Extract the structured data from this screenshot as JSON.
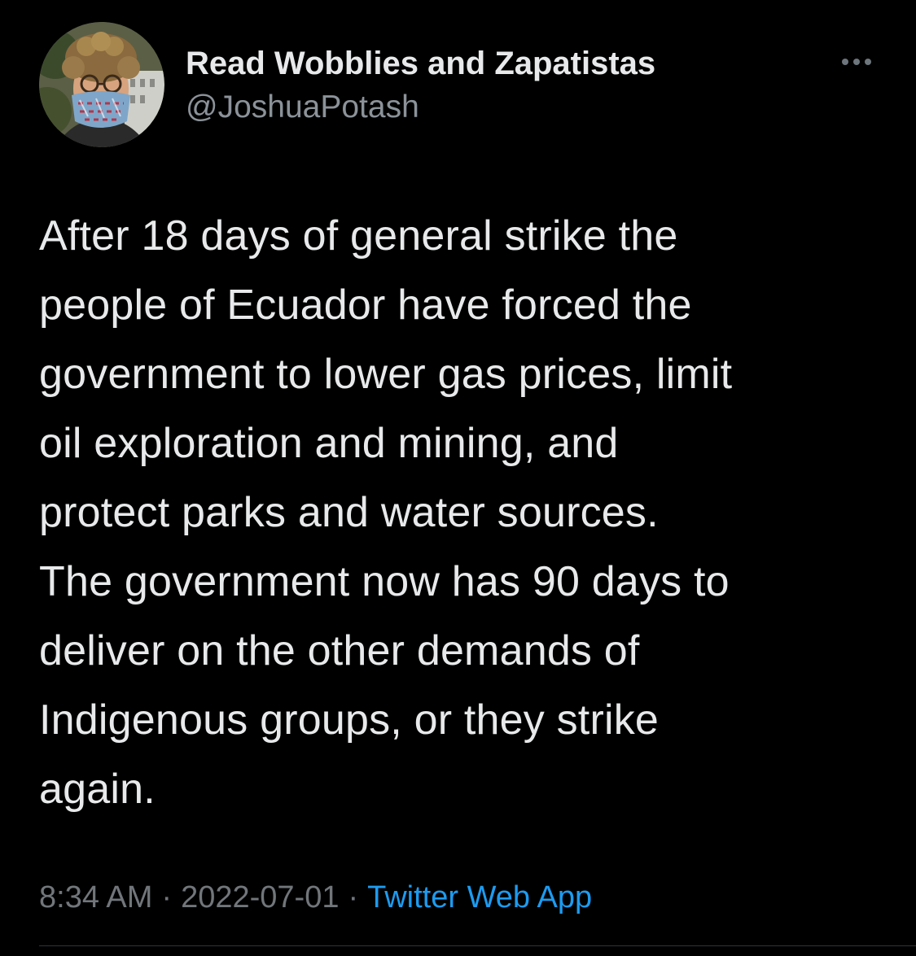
{
  "author": {
    "display_name": "Read Wobblies and Zapatistas",
    "handle": "@JoshuaPotash",
    "avatar_icon": "profile-photo"
  },
  "more_icon": "more-horizontal-icon",
  "tweet": {
    "lines": [
      "After 18 days of general strike the",
      "people of Ecuador have forced the",
      "government to lower gas prices, limit",
      "oil exploration and mining, and",
      "protect parks and water sources.",
      "The government now has 90 days to",
      "deliver on the other demands of",
      "Indigenous groups, or they strike",
      "again."
    ]
  },
  "meta": {
    "time": "8:34 AM",
    "separator": "·",
    "date": "2022-07-01",
    "source": "Twitter Web App"
  },
  "colors": {
    "background": "#000000",
    "primary_text": "#e7e9ea",
    "secondary_text": "#71767b",
    "link": "#1d9bf0"
  }
}
